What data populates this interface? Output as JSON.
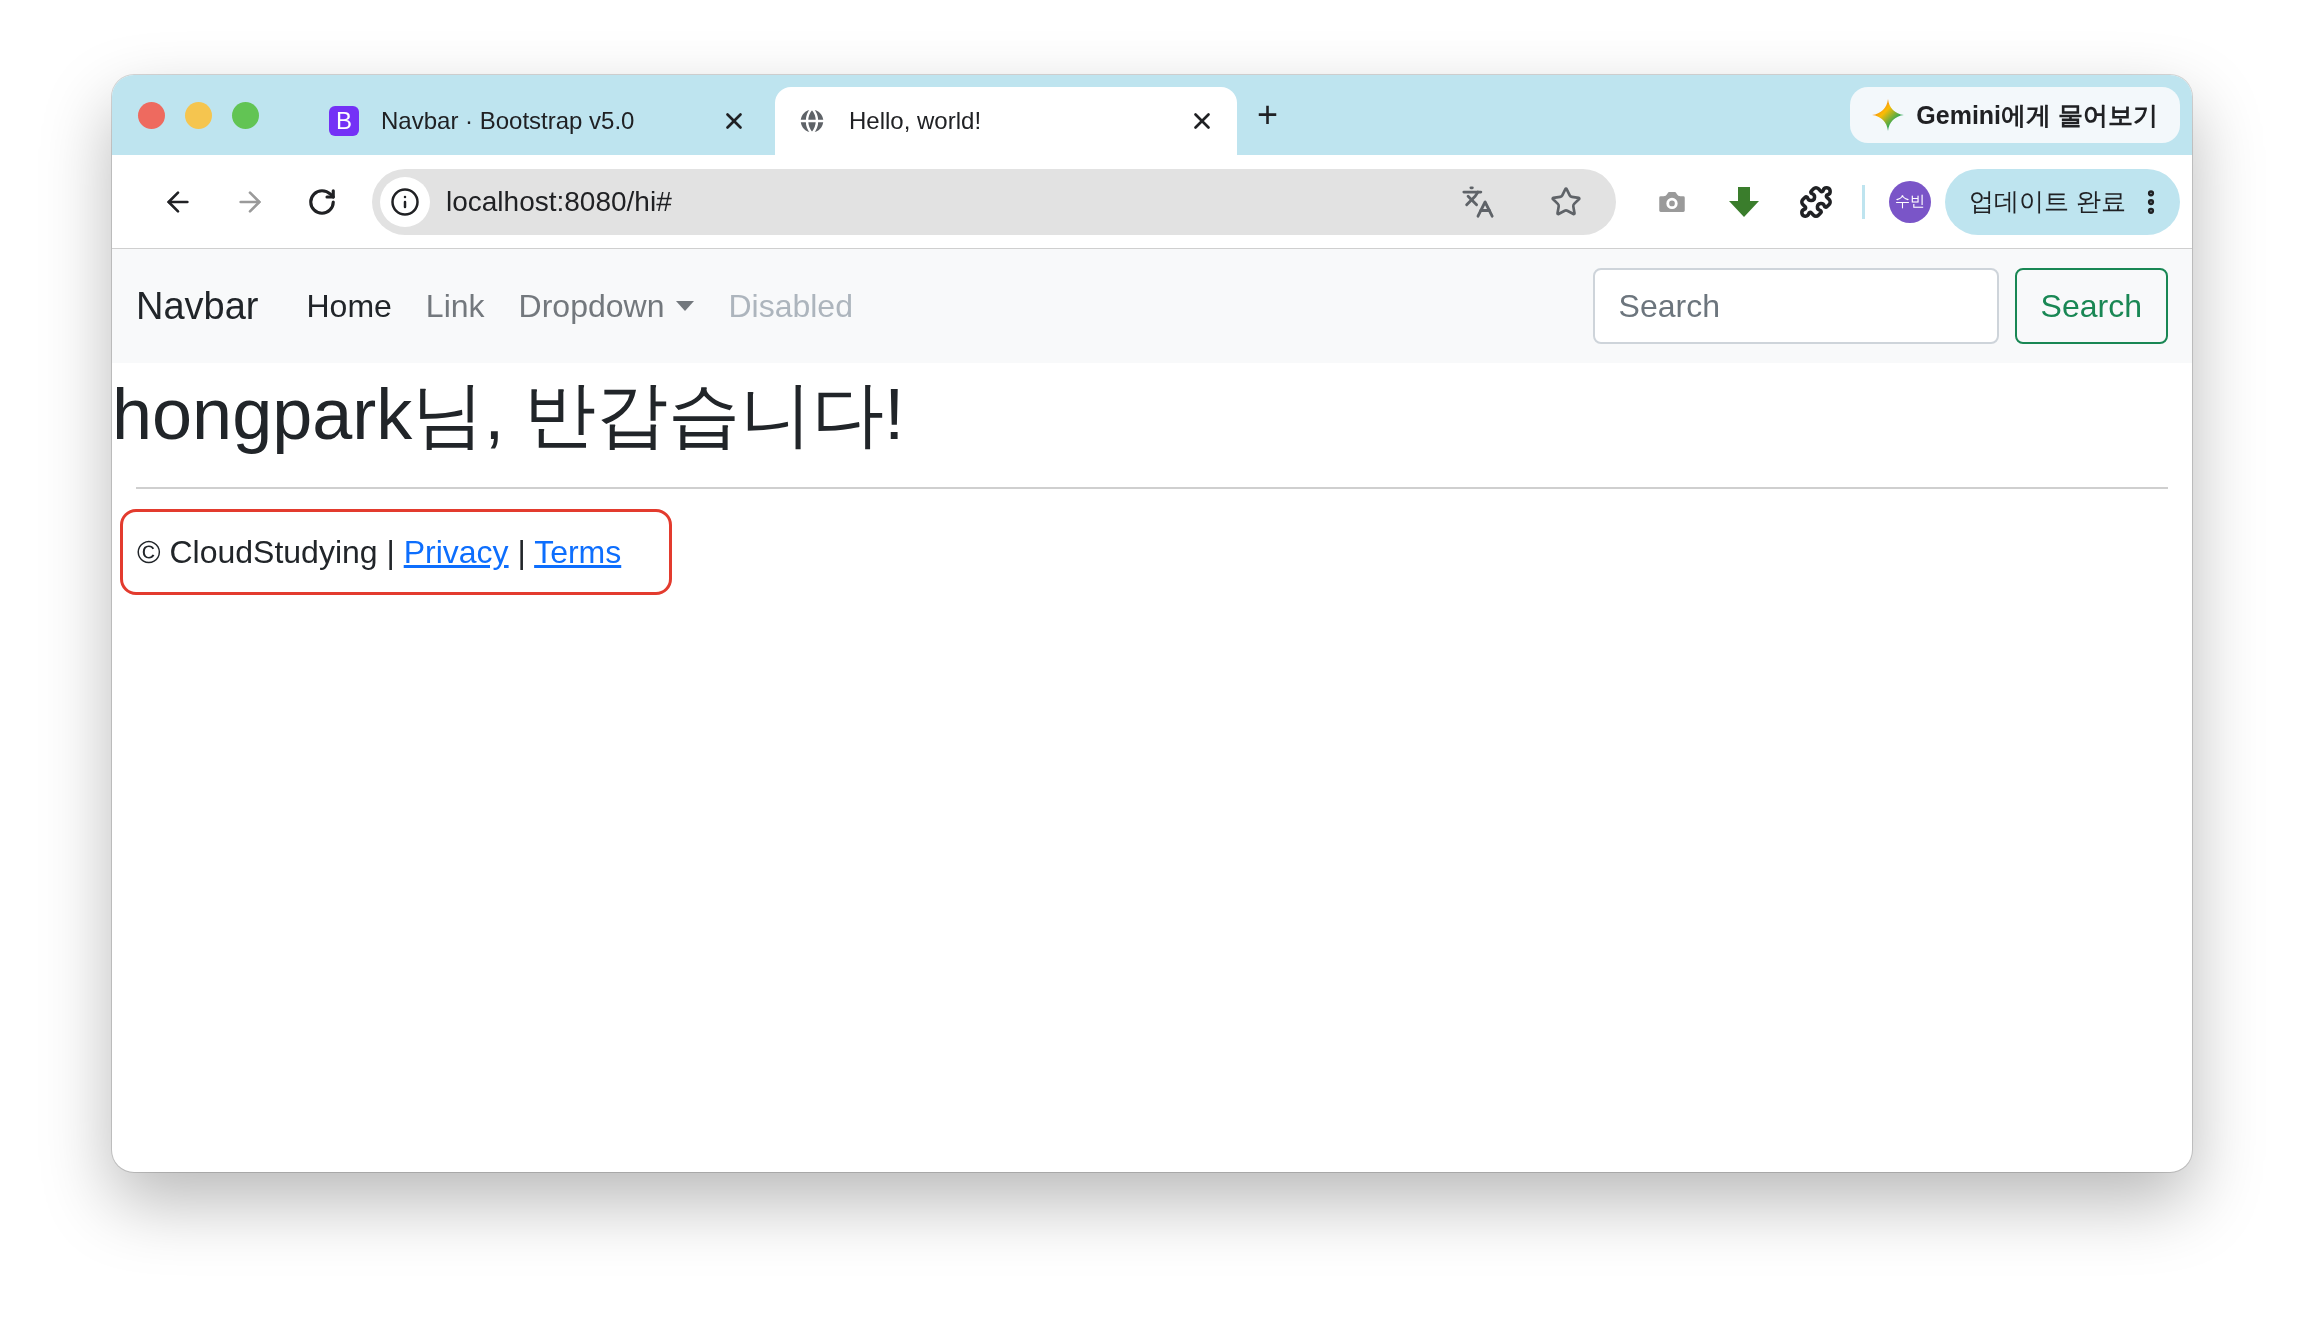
{
  "tabs": [
    {
      "kind": "letter",
      "favicon_text": "B",
      "title": "Navbar · Bootstrap v5.0",
      "selected": false
    },
    {
      "kind": "globe",
      "title": "Hello, world!",
      "selected": true
    }
  ],
  "new_tab": "+",
  "gemini": {
    "label": "Gemini에게 물어보기"
  },
  "address": {
    "url": "localhost:8080/hi#"
  },
  "profile": {
    "initials": "수빈"
  },
  "update": {
    "label": "업데이트 완료"
  },
  "navbar": {
    "brand": "Navbar",
    "items": [
      {
        "label": "Home",
        "active": true,
        "disabled": false,
        "dropdown": false
      },
      {
        "label": "Link",
        "active": false,
        "disabled": false,
        "dropdown": false
      },
      {
        "label": "Dropdown",
        "active": false,
        "disabled": false,
        "dropdown": true
      },
      {
        "label": "Disabled",
        "active": false,
        "disabled": true,
        "dropdown": false
      }
    ],
    "search": {
      "placeholder": "Search",
      "button": "Search"
    }
  },
  "heading": "hongpark님, 반갑습니다!",
  "footer": {
    "text": "© CloudStudying |",
    "links": [
      {
        "label": "Privacy"
      },
      {
        "label": "Terms"
      }
    ],
    "separator": "|",
    "highlighted": true
  }
}
